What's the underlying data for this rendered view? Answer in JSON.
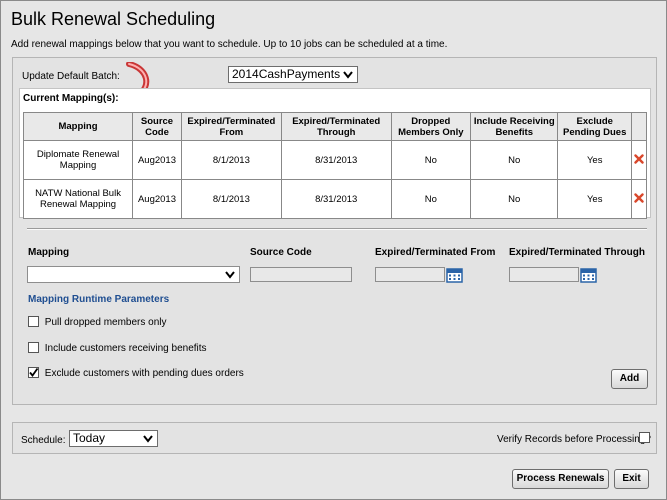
{
  "page": {
    "title": "Bulk Renewal Scheduling",
    "subtitle": "Add renewal mappings below that you want to schedule. Up to 10 jobs can be scheduled at a time."
  },
  "batch": {
    "label": "Update Default Batch:",
    "selected": "2014CashPayments"
  },
  "current_mappings": {
    "label": "Current Mapping(s):",
    "columns": [
      "Mapping",
      "Source Code",
      "Expired/Terminated From",
      "Expired/Terminated Through",
      "Dropped Members Only",
      "Include Receiving Benefits",
      "Exclude Pending Dues"
    ],
    "rows": [
      [
        "Diplomate Renewal Mapping",
        "Aug2013",
        "8/1/2013",
        "8/31/2013",
        "No",
        "No",
        "Yes"
      ],
      [
        "NATW National Bulk Renewal Mapping",
        "Aug2013",
        "8/1/2013",
        "8/31/2013",
        "No",
        "No",
        "Yes"
      ]
    ]
  },
  "form": {
    "mapping_label": "Mapping",
    "source_code_label": "Source Code",
    "from_label": "Expired/Terminated From",
    "through_label": "Expired/Terminated Through",
    "runtime_label": "Mapping Runtime Parameters",
    "options": [
      {
        "label": "Pull dropped members only",
        "checked": false
      },
      {
        "label": "Include customers receiving benefits",
        "checked": false
      },
      {
        "label": "Exclude customers with pending dues orders",
        "checked": true
      }
    ],
    "add_button": "Add"
  },
  "schedule": {
    "label": "Schedule:",
    "selected": "Today",
    "verify_label": "Verify Records before Processing?",
    "verify_checked": false
  },
  "buttons": {
    "process": "Process Renewals",
    "exit": "Exit"
  },
  "colors": {
    "accent": "#1f4e91",
    "delete": "#d9472b",
    "calendar": "#2b64a8"
  }
}
